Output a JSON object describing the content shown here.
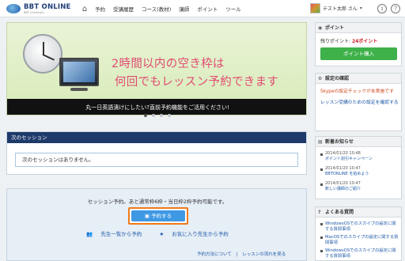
{
  "header": {
    "logo_text": "BBT ONLINE",
    "logo_sub": "BBT University",
    "nav": [
      {
        "label": "予約"
      },
      {
        "label": "受講履歴"
      },
      {
        "label": "コース(教材)"
      },
      {
        "label": "講師"
      },
      {
        "label": "ポイント"
      },
      {
        "label": "ツール"
      }
    ],
    "user_name": "テスト太郎 さん"
  },
  "banner": {
    "line1": "2時間以内の空き枠は",
    "line2": "何回でもレッスン予約できます",
    "strip": "丸一日英語漬けにしたい?直前予約機能をご活用ください!"
  },
  "session": {
    "title": "次のセッション",
    "empty_text": "次のセッションはありません。"
  },
  "reserve": {
    "text": "セッション予約。あと通常枠6枠・当日枠2枠予約可能です。",
    "button": "予約する",
    "link_teachers": "先生一覧から予約",
    "link_favorites": "お気に入り先生から予約",
    "footer_link1": "予約方法について",
    "footer_link2": "レッスンの流れを見る"
  },
  "sidebar": {
    "points": {
      "title": "ポイント",
      "remaining_label": "残りポイント: ",
      "remaining_value": "24ポイント",
      "buy_button": "ポイント購入"
    },
    "settings": {
      "title": "設定の確認",
      "warning": "Skypeの設定チェックが未実施です",
      "link": "レッスン受講のための設定を確認する"
    },
    "news": {
      "title": "新着お知らせ",
      "items": [
        {
          "date": "2014/01/20 10:48",
          "title": "ポイント割引キャンペーン"
        },
        {
          "date": "2014/01/20 10:47",
          "title": "BBTONLINE を始めよう"
        },
        {
          "date": "2014/01/20 10:47",
          "title": "新しい講師のご紹介"
        }
      ]
    },
    "faq": {
      "title": "よくある質問",
      "items": [
        {
          "label": "WindowsOSでのスカイプの設定に関する質問事項"
        },
        {
          "label": "MacOSでのスカイプの設定に関する質問事項"
        },
        {
          "label": "WindowsOSでのスカイプの設定に関する質問事項"
        }
      ]
    }
  }
}
